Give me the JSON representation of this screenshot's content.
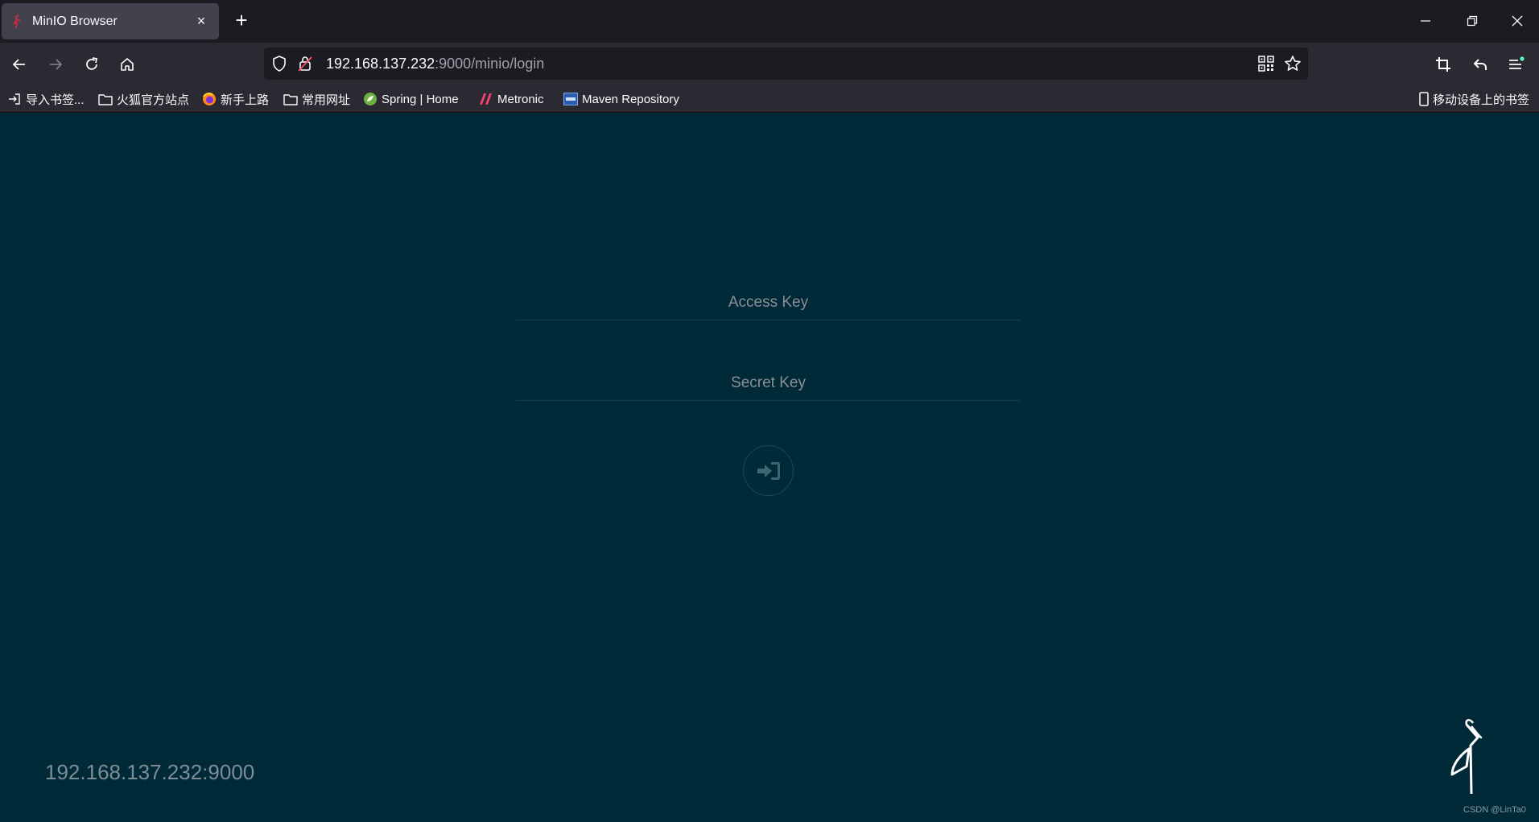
{
  "tab": {
    "title": "MinIO Browser",
    "close_label": "×",
    "new_tab_label": "+"
  },
  "urlbar": {
    "host": "192.168.137.232",
    "rest": ":9000/minio/login"
  },
  "bookmarks": {
    "left": [
      {
        "label": "导入书签...",
        "icon": "import-icon"
      },
      {
        "label": "火狐官方站点",
        "icon": "folder-icon"
      },
      {
        "label": "新手上路",
        "icon": "firefox-icon"
      },
      {
        "label": "常用网址",
        "icon": "folder-icon"
      },
      {
        "label": "Spring | Home",
        "icon": "spring-icon"
      },
      {
        "label": "Metronic",
        "icon": "metronic-icon"
      },
      {
        "label": "Maven Repository",
        "icon": "maven-icon"
      }
    ],
    "mobile": {
      "label": "移动设备上的书签",
      "icon": "mobile-icon"
    }
  },
  "login": {
    "access_key_placeholder": "Access Key",
    "secret_key_placeholder": "Secret Key",
    "submit_icon": "sign-in-icon"
  },
  "footer": {
    "host_label": "192.168.137.232:9000",
    "watermark": "CSDN @LinTa0"
  },
  "colors": {
    "page_background": "#002a37",
    "tabbar_background": "#1c1b22",
    "toolbar_background": "#2b2a33"
  }
}
